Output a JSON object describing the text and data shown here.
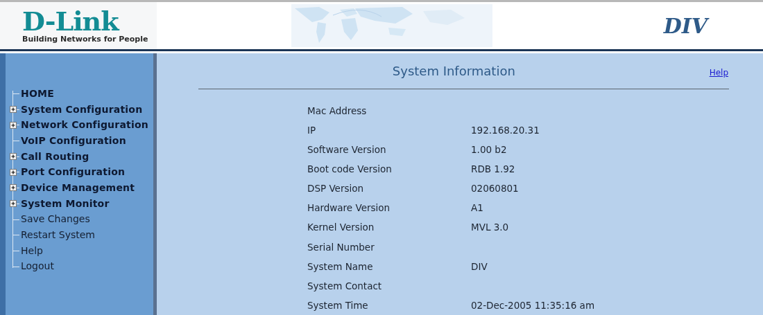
{
  "header": {
    "logo": {
      "brand": "D-Link",
      "tagline": "Building Networks for People"
    },
    "model": "DIV"
  },
  "sidebar": {
    "items": [
      {
        "label": "HOME",
        "kind": "section",
        "expandable": false
      },
      {
        "label": "System Configuration",
        "kind": "section",
        "expandable": true
      },
      {
        "label": "Network Configuration",
        "kind": "section",
        "expandable": true
      },
      {
        "label": "VoIP Configuration",
        "kind": "section",
        "expandable": false
      },
      {
        "label": "Call Routing",
        "kind": "section",
        "expandable": true
      },
      {
        "label": "Port Configuration",
        "kind": "section",
        "expandable": true
      },
      {
        "label": "Device Management",
        "kind": "section",
        "expandable": true
      },
      {
        "label": "System Monitor",
        "kind": "section",
        "expandable": true
      },
      {
        "label": "Save Changes",
        "kind": "action",
        "expandable": false
      },
      {
        "label": "Restart System",
        "kind": "action",
        "expandable": false
      },
      {
        "label": "Help",
        "kind": "action",
        "expandable": false
      },
      {
        "label": "Logout",
        "kind": "action",
        "expandable": false
      }
    ]
  },
  "content": {
    "title": "System Information",
    "help_link": "Help",
    "rows": [
      {
        "label": "Mac Address"
      },
      {
        "label": "IP",
        "value": "192.168.20.31"
      },
      {
        "label": "Software Version",
        "value": "1.00 b2"
      },
      {
        "label": "Boot code Version",
        "value": "RDB 1.92"
      },
      {
        "label": "DSP Version",
        "value": "02060801"
      },
      {
        "label": "Hardware Version",
        "value": "A1"
      },
      {
        "label": "Kernel Version",
        "value": "MVL 3.0"
      },
      {
        "label": "Serial Number"
      },
      {
        "label": "System Name",
        "value": "DIV"
      },
      {
        "label": "System Contact"
      },
      {
        "label": "System Time",
        "value": "02-Dec-2005 11:35:16 am"
      }
    ]
  }
}
